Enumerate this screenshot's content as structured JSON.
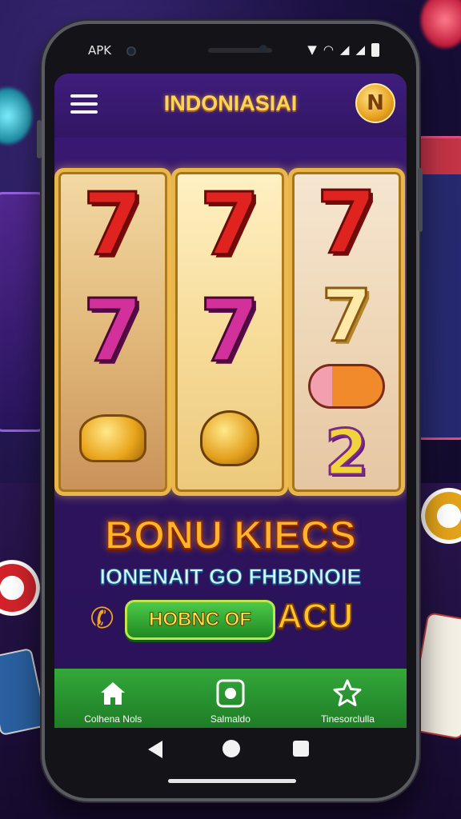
{
  "status_bar": {
    "left_text": "APK",
    "icons": [
      "notification-icon",
      "wifi-icon",
      "signal-icon",
      "signal-icon",
      "battery-icon"
    ]
  },
  "app_bar": {
    "title": "INDONIASIAI",
    "coin_symbol": "N",
    "menu_icon": "hamburger-menu-icon"
  },
  "reels": [
    {
      "symbols": [
        "7",
        "7",
        "gold-bar"
      ]
    },
    {
      "symbols": [
        "7",
        "7",
        "golden-bell"
      ]
    },
    {
      "symbols": [
        "7",
        "7",
        "fruit",
        "2"
      ]
    }
  ],
  "promo": {
    "title": "BONU KIECS",
    "subtitle": "IONENAIT GO FHBDNOIE",
    "cta_label": "HOBNC OF",
    "side_text": "ACU",
    "phone_icon": "phone-icon"
  },
  "bottom_nav": [
    {
      "label": "Colhena Nols",
      "icon": "home-icon"
    },
    {
      "label": "Salmaldo",
      "icon": "camera-icon"
    },
    {
      "label": "Tinesorclulla",
      "icon": "star-icon"
    }
  ],
  "colors": {
    "title_gold": "#ffd454",
    "screen_purple": "#3c1a78",
    "nav_green": "#2a9a33",
    "cta_green": "#34b53a"
  }
}
